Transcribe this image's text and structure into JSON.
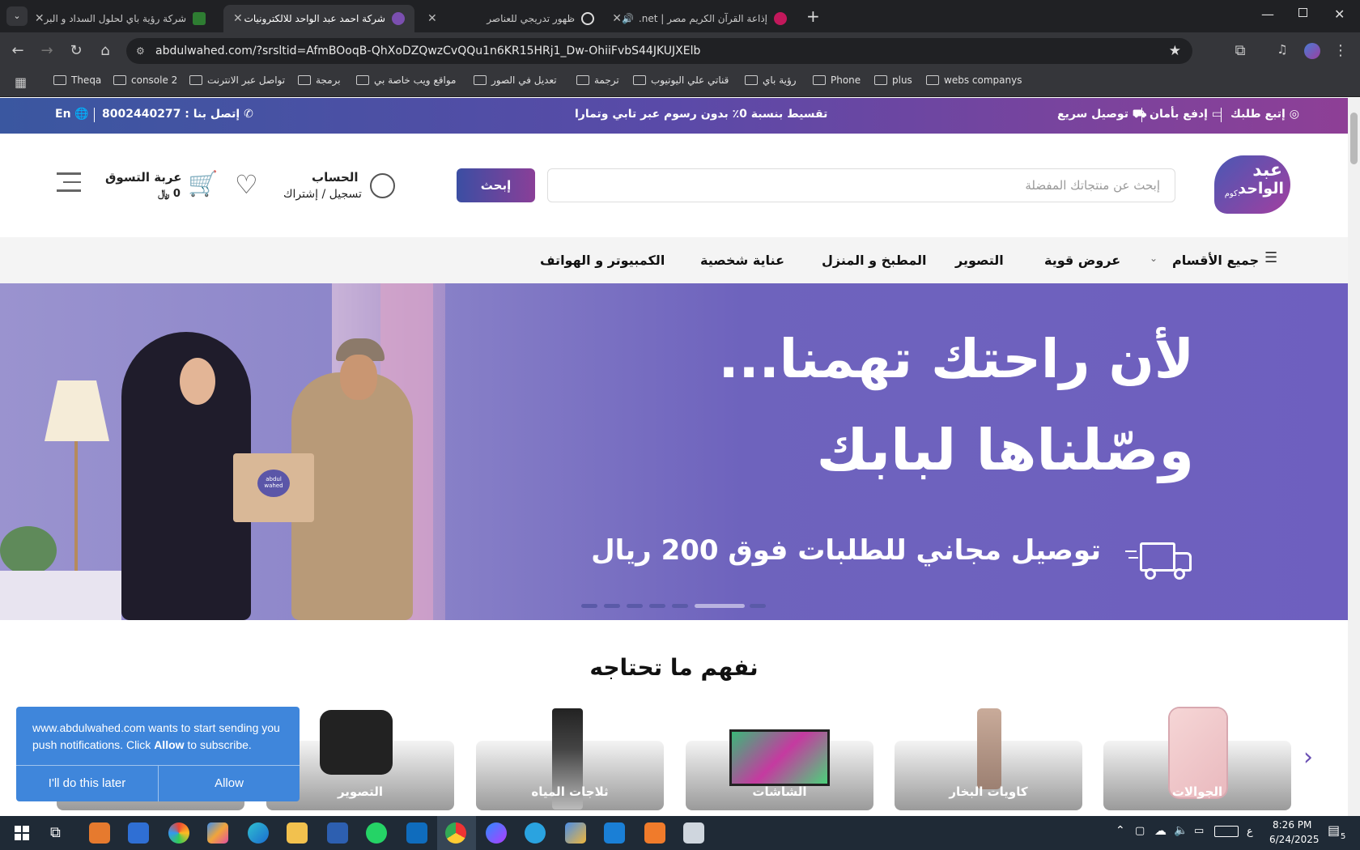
{
  "browser": {
    "tabs": [
      {
        "title": "شركة رؤية باي لحلول السداد و البر",
        "favicon_color": "#2e7d32",
        "active": false
      },
      {
        "title": "شركة احمد عبد الواحد للالكترونيات",
        "favicon_color": "#7b4fb0",
        "active": true
      },
      {
        "title": "ظهور تدريجي للعناصر",
        "favicon_color": "#e0e0e0",
        "active": false
      },
      {
        "title": "إذاعة القرآن الكريم مصر | net.",
        "favicon_color": "#c2185b",
        "active": false
      }
    ],
    "url": "abdulwahed.com/?srsltid=AfmBOoqB-QhXoDZQwzCvQQu1n6KR15HRj1_Dw-OhiiFvbS44JKUJXElb",
    "bookmarks": [
      "Theqa",
      "console 2",
      "تواصل عبر الانترنت",
      "برمجة",
      "مواقع ويب خاصة بي",
      "تعديل في الصور",
      "ترجمة",
      "قناتي علي اليوتيوب",
      "رؤية باي",
      "Phone",
      "plus",
      "webs companys"
    ]
  },
  "topbar": {
    "track": "إتبع طلبك",
    "pay": "إدفع بأمان",
    "delivery": "توصيل سريع",
    "promo": "تقسيط بنسبة 0٪ بدون رسوم عبر تابي وتمارا",
    "contact": "إتصل بنا : 8002440277",
    "lang": "En"
  },
  "header": {
    "logo_top": "عبد",
    "logo_bottom": "الواحد",
    "logo_suffix": ".كوم",
    "search_placeholder": "إبحث عن منتجاتك المفضلة",
    "search_button": "إبحث",
    "account_title": "الحساب",
    "account_sub": "تسجيل / إشتراك",
    "cart_title": "عربة التسوق",
    "cart_count": "0 ﷼"
  },
  "nav": {
    "all": "جميع الأقسام",
    "items": [
      "عروض قوية",
      "التصوير",
      "المطبخ و المنزل",
      "عناية شخصية",
      "الكمبيوتر و الهواتف"
    ]
  },
  "hero": {
    "line1": "لأن راحتك تهمنا...",
    "line2": "وصّلناها لبابك",
    "line3": "توصيل مجاني للطلبات فوق 200 ريال",
    "box_text": "abdul wahed"
  },
  "section": {
    "title": "نفهم ما تحتاجه",
    "categories": [
      "الجوالات",
      "كاويات البخار",
      "الشاشات",
      "ثلاجات المياه",
      "التصوير"
    ]
  },
  "notification": {
    "text_prefix": "www.abdulwahed.com wants to start sending you push notifications. Click ",
    "text_bold": "Allow",
    "text_suffix": " to subscribe.",
    "later": "I'll do this later",
    "allow": "Allow"
  },
  "taskbar": {
    "time": "8:26 PM",
    "date": "6/24/2025",
    "lang": "ع",
    "notif_count": "5"
  },
  "colors": {
    "brand_purple": "#6a4fb3",
    "brand_gradient_start": "#3b4ea3",
    "brand_gradient_end": "#8a3f98",
    "notif_blue": "#3f86db"
  }
}
